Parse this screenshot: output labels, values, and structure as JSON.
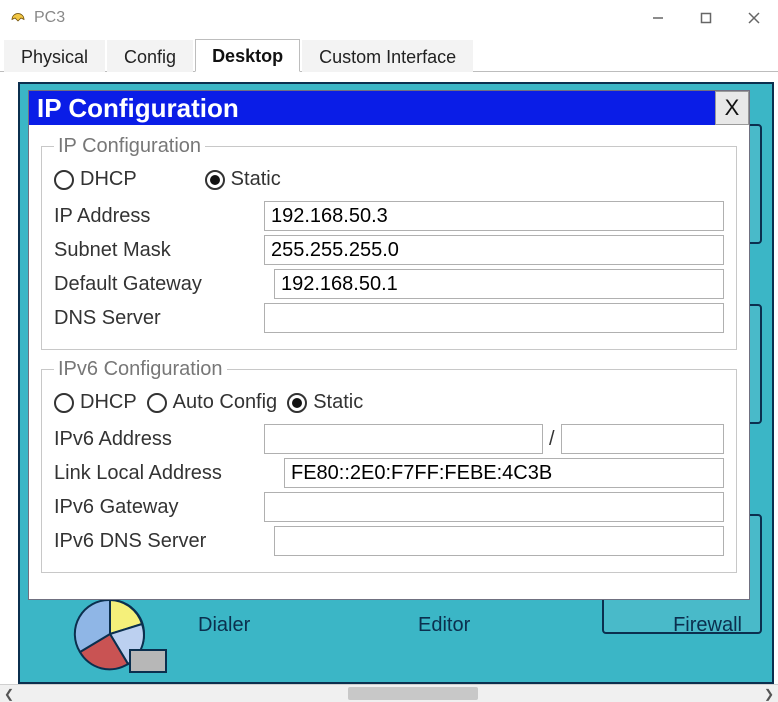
{
  "window": {
    "title": "PC3"
  },
  "tabs": [
    "Physical",
    "Config",
    "Desktop",
    "Custom Interface"
  ],
  "active_tab_index": 2,
  "dialog": {
    "title": "IP Configuration",
    "close_label": "X",
    "ipv4": {
      "legend": "IP Configuration",
      "mode_labels": {
        "dhcp": "DHCP",
        "static": "Static"
      },
      "mode": "static",
      "fields": {
        "ip_address_label": "IP Address",
        "ip_address": "192.168.50.3",
        "subnet_label": "Subnet Mask",
        "subnet": "255.255.255.0",
        "gateway_label": "Default Gateway",
        "gateway": "192.168.50.1",
        "dns_label": "DNS Server",
        "dns": ""
      }
    },
    "ipv6": {
      "legend": "IPv6 Configuration",
      "mode_labels": {
        "dhcp": "DHCP",
        "auto": "Auto Config",
        "static": "Static"
      },
      "mode": "static",
      "fields": {
        "addr_label": "IPv6 Address",
        "addr": "",
        "prefix_separator": "/",
        "prefix": "",
        "link_local_label": "Link Local Address",
        "link_local": "FE80::2E0:F7FF:FEBE:4C3B",
        "gateway_label": "IPv6 Gateway",
        "gateway": "",
        "dns_label": "IPv6 DNS Server",
        "dns": ""
      }
    }
  },
  "background_labels": {
    "left": "Dialer",
    "center": "Editor",
    "right": "Firewall"
  }
}
